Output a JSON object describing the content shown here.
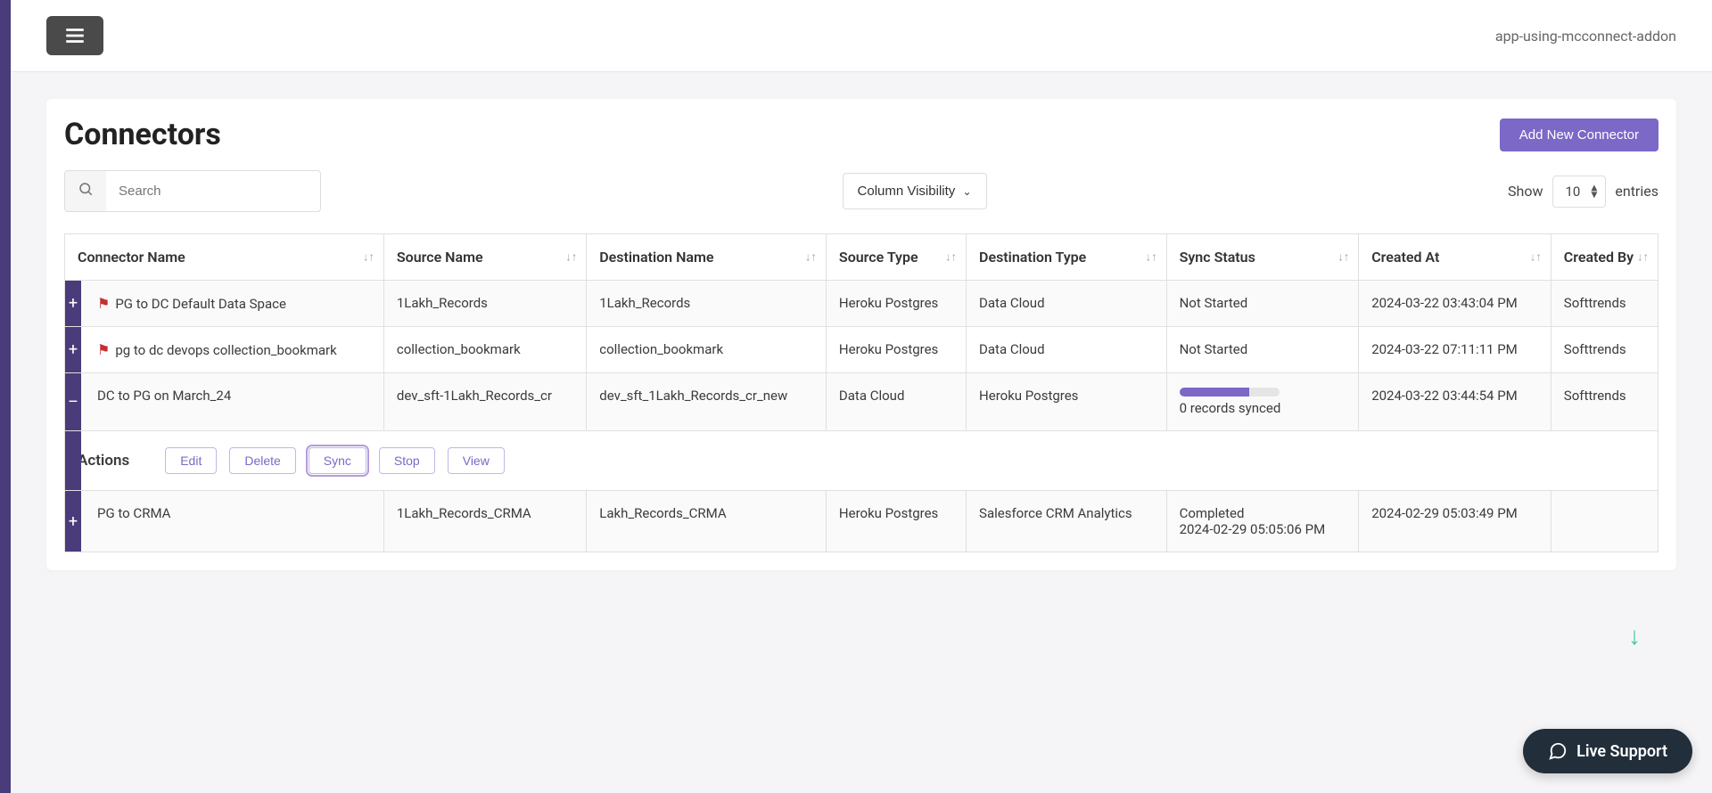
{
  "header": {
    "app_name": "app-using-mcconnect-addon"
  },
  "page": {
    "title": "Connectors",
    "add_button": "Add New Connector"
  },
  "toolbar": {
    "search_placeholder": "Search",
    "column_visibility": "Column Visibility",
    "show_label": "Show",
    "entries_value": "10",
    "entries_label": "entries"
  },
  "table": {
    "columns": [
      "Connector Name",
      "Source Name",
      "Destination Name",
      "Source Type",
      "Destination Type",
      "Sync Status",
      "Created At",
      "Created By"
    ],
    "rows": [
      {
        "expand": "+",
        "flagged": true,
        "connector_name": "PG to DC Default Data Space",
        "source_name": "1Lakh_Records",
        "destination_name": "1Lakh_Records",
        "source_type": "Heroku Postgres",
        "destination_type": "Data Cloud",
        "sync_status": "Not Started",
        "created_at": "2024-03-22 03:43:04 PM",
        "created_by": "Softtrends"
      },
      {
        "expand": "+",
        "flagged": true,
        "connector_name": "pg to dc devops collection_bookmark",
        "source_name": "collection_bookmark",
        "destination_name": "collection_bookmark",
        "source_type": "Heroku Postgres",
        "destination_type": "Data Cloud",
        "sync_status": "Not Started",
        "created_at": "2024-03-22 07:11:11 PM",
        "created_by": "Softtrends"
      },
      {
        "expand": "–",
        "flagged": false,
        "connector_name": "DC to PG on March_24",
        "source_name": "dev_sft-1Lakh_Records_cr",
        "destination_name": "dev_sft_1Lakh_Records_cr_new",
        "source_type": "Data Cloud",
        "destination_type": "Heroku Postgres",
        "sync_status_detail": "0 records synced",
        "created_at": "2024-03-22 03:44:54 PM",
        "created_by": "Softtrends"
      },
      {
        "expand": "+",
        "flagged": false,
        "connector_name": "PG to CRMA",
        "source_name": "1Lakh_Records_CRMA",
        "destination_name": "Lakh_Records_CRMA",
        "source_type": "Heroku Postgres",
        "destination_type": "Salesforce CRM Analytics",
        "sync_status": "Completed",
        "sync_status_ts": "2024-02-29 05:05:06 PM",
        "created_at": "2024-02-29 05:03:49 PM",
        "created_by": ""
      }
    ]
  },
  "actions": {
    "label": "Actions",
    "edit": "Edit",
    "delete": "Delete",
    "sync": "Sync",
    "stop": "Stop",
    "view": "View"
  },
  "live_support": "Live Support"
}
